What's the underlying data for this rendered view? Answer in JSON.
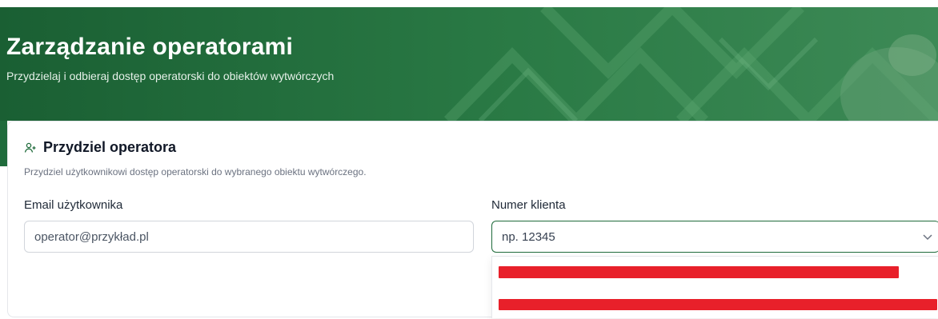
{
  "header": {
    "title": "Zarządzanie operatorami",
    "subtitle": "Przydzielaj i odbieraj dostęp operatorski do obiektów wytwórczych"
  },
  "card": {
    "icon": "user-plus-icon",
    "title": "Przydziel operatora",
    "description": "Przydziel użytkownikowi dostęp operatorski do wybranego obiektu wytwórczego."
  },
  "form": {
    "email_label": "Email użytkownika",
    "email_placeholder": "operator@przykład.pl",
    "client_label": "Numer klienta",
    "client_placeholder": "np. 12345"
  },
  "dropdown": {
    "options": [
      "",
      ""
    ]
  },
  "colors": {
    "brand": "#1f6b3b",
    "redaction": "#e8202a"
  }
}
